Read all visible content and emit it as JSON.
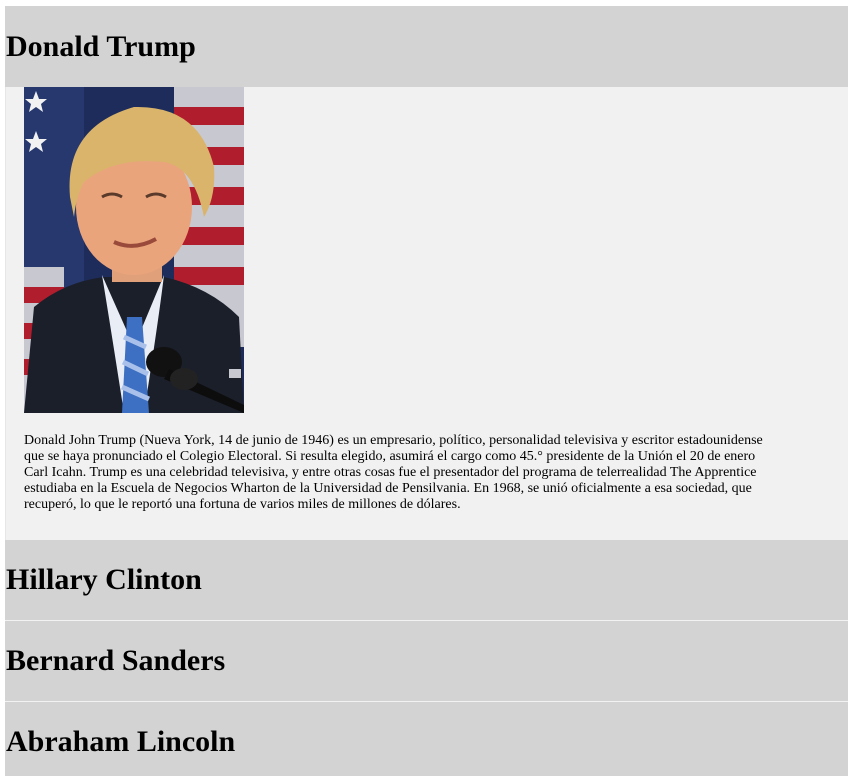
{
  "sections": [
    {
      "title": "Donald Trump",
      "expanded": true,
      "image": {
        "alt": "portrait",
        "icon": "portrait-photo"
      },
      "bio_lines": [
        "Donald John Trump (Nueva York, 14 de junio de 1946) es un empresario, político, personalidad televisiva y escritor estadounidense",
        "que se haya pronunciado el Colegio Electoral. Si resulta elegido, asumirá el cargo como 45.° presidente de la Unión el 20 de enero",
        "Carl Icahn. Trump es una celebridad televisiva, y entre otras cosas fue el presentador del programa de telerrealidad The Apprentice",
        "estudiaba en la Escuela de Negocios Wharton de la Universidad de Pensilvania. En 1968, se unió oficialmente a esa sociedad, que",
        "recuperó, lo que le reportó una fortuna de varios miles de millones de dólares."
      ]
    },
    {
      "title": "Hillary Clinton",
      "expanded": false
    },
    {
      "title": "Bernard Sanders",
      "expanded": false
    },
    {
      "title": "Abraham Lincoln",
      "expanded": false
    }
  ],
  "colors": {
    "header_bg": "#d3d3d3",
    "panel_bg": "#f1f1f1"
  }
}
